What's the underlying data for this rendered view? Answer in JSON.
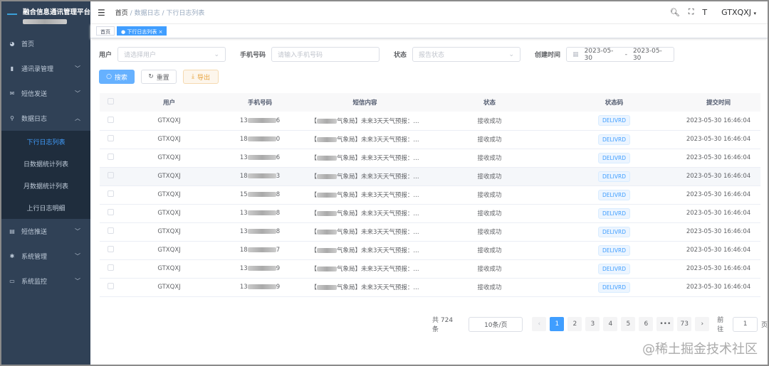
{
  "app": {
    "title": "融合信息通讯管理平台"
  },
  "sidebar": {
    "items": [
      {
        "label": "首页",
        "icon": "dashboard-icon"
      },
      {
        "label": "通讯录管理",
        "icon": "chart-icon",
        "chevron": "down"
      },
      {
        "label": "短信发送",
        "icon": "mail-icon",
        "chevron": "down"
      },
      {
        "label": "数据日志",
        "icon": "search-icon",
        "chevron": "up"
      }
    ],
    "sub": [
      {
        "label": "下行日志列表",
        "active": true
      },
      {
        "label": "日数据统计列表"
      },
      {
        "label": "月数据统计列表"
      },
      {
        "label": "上行日志明细"
      }
    ],
    "items2": [
      {
        "label": "短信推送",
        "icon": "list-icon",
        "chevron": "down"
      },
      {
        "label": "系统管理",
        "icon": "gear-icon",
        "chevron": "down"
      },
      {
        "label": "系统监控",
        "icon": "monitor-icon",
        "chevron": "down"
      }
    ]
  },
  "header": {
    "breadcrumb": [
      "首页",
      "数据日志",
      "下行日志列表"
    ],
    "sep": "/",
    "user": "GTXQXJ"
  },
  "tags": [
    {
      "label": "首页"
    },
    {
      "label": "下行日志列表",
      "active": true
    }
  ],
  "filters": {
    "user_label": "用户",
    "user_ph": "请选择用户",
    "phone_label": "手机号码",
    "phone_ph": "请输入手机号码",
    "status_label": "状态",
    "status_ph": "报告状态",
    "time_label": "创建时间",
    "start": "2023-05-30",
    "dash": "-",
    "end": "2023-05-30"
  },
  "buttons": {
    "search": "搜索",
    "reset": "重置",
    "export": "导出"
  },
  "table": {
    "headers": [
      "用户",
      "手机号码",
      "短信内容",
      "状态",
      "状态码",
      "提交时间"
    ],
    "rows": [
      {
        "user": "GTXQXJ",
        "pre": "13",
        "last": "6",
        "content": "气象局】未来3天天气预报：...",
        "status": "接收成功",
        "code": "DELIVRD",
        "time": "2023-05-30 16:46:04"
      },
      {
        "user": "GTXQXJ",
        "pre": "18",
        "last": "0",
        "content": "气象局】未来3天天气预报：...",
        "status": "接收成功",
        "code": "DELIVRD",
        "time": "2023-05-30 16:46:04"
      },
      {
        "user": "GTXQXJ",
        "pre": "13",
        "last": "6",
        "content": "气象局】未来3天天气预报：...",
        "status": "接收成功",
        "code": "DELIVRD",
        "time": "2023-05-30 16:46:04"
      },
      {
        "user": "GTXQXJ",
        "pre": "18",
        "last": "3",
        "content": "气象局】未来3天天气预报：...",
        "status": "接收成功",
        "code": "DELIVRD",
        "time": "2023-05-30 16:46:04"
      },
      {
        "user": "GTXQXJ",
        "pre": "15",
        "last": "8",
        "content": "气象局】未来3天天气预报：...",
        "status": "接收成功",
        "code": "DELIVRD",
        "time": "2023-05-30 16:46:04"
      },
      {
        "user": "GTXQXJ",
        "pre": "13",
        "last": "8",
        "content": "气象局】未来3天天气预报：...",
        "status": "接收成功",
        "code": "DELIVRD",
        "time": "2023-05-30 16:46:04"
      },
      {
        "user": "GTXQXJ",
        "pre": "13",
        "last": "8",
        "content": "气象局】未来3天天气预报：...",
        "status": "接收成功",
        "code": "DELIVRD",
        "time": "2023-05-30 16:46:04"
      },
      {
        "user": "GTXQXJ",
        "pre": "18",
        "last": "7",
        "content": "气象局】未来3天天气预报：...",
        "status": "接收成功",
        "code": "DELIVRD",
        "time": "2023-05-30 16:46:04"
      },
      {
        "user": "GTXQXJ",
        "pre": "13",
        "last": "9",
        "content": "气象局】未来3天天气预报：...",
        "status": "接收成功",
        "code": "DELIVRD",
        "time": "2023-05-30 16:46:04"
      },
      {
        "user": "GTXQXJ",
        "pre": "13",
        "last": "9",
        "content": "气象局】未来3天天气预报：...",
        "status": "接收成功",
        "code": "DELIVRD",
        "time": "2023-05-30 16:46:04"
      }
    ]
  },
  "pagination": {
    "total": "共 724 条",
    "size": "10条/页",
    "pages": [
      "1",
      "2",
      "3",
      "4",
      "5",
      "6",
      "•••",
      "73"
    ],
    "goto": "前往",
    "page": "1",
    "page_suffix": "页"
  },
  "watermark": "@稀土掘金技术社区"
}
